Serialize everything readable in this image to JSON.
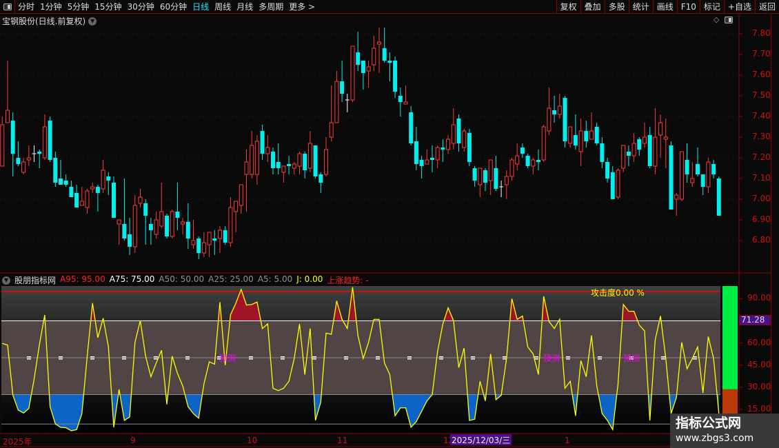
{
  "toolbar": {
    "periods": [
      "分时",
      "1分钟",
      "5分钟",
      "15分钟",
      "30分钟",
      "60分钟",
      "日线",
      "周线",
      "月线",
      "多周期",
      "更多 >"
    ],
    "active": "日线",
    "right_buttons": [
      "复权",
      "叠加",
      "多股",
      "统计",
      "画线",
      "F10",
      "标记",
      "+自选",
      "返回"
    ]
  },
  "chart": {
    "title": "宝钢股份(日线.前复权)",
    "price_labels": [
      "7.80",
      "7.70",
      "7.60",
      "7.50",
      "7.40",
      "7.30",
      "7.20",
      "7.10",
      "7.00",
      "6.90",
      "6.80"
    ],
    "colors": {
      "up": "#ff3b3b",
      "down": "#00f0f0",
      "doji": "#ffffff"
    },
    "candles": [
      [
        7.16,
        7.4,
        7.16,
        7.36
      ],
      [
        7.37,
        7.67,
        7.37,
        7.43
      ],
      [
        7.38,
        7.42,
        7.11,
        7.22
      ],
      [
        7.2,
        7.28,
        7.16,
        7.17
      ],
      [
        7.13,
        7.2,
        7.12,
        7.18
      ],
      [
        7.19,
        7.26,
        7.16,
        7.2
      ],
      [
        7.22,
        7.26,
        7.18,
        7.22
      ],
      [
        7.23,
        7.24,
        7.15,
        7.22
      ],
      [
        7.2,
        7.41,
        7.19,
        7.35
      ],
      [
        7.38,
        7.4,
        7.18,
        7.19
      ],
      [
        7.2,
        7.23,
        7.06,
        7.08
      ],
      [
        7.1,
        7.19,
        7.07,
        7.07
      ],
      [
        7.09,
        7.12,
        7.06,
        7.07
      ],
      [
        7.06,
        7.09,
        7.01,
        7.01
      ],
      [
        7.03,
        7.07,
        6.96,
        6.96
      ],
      [
        6.97,
        7.06,
        6.97,
        6.99
      ],
      [
        6.96,
        7.05,
        6.93,
        7.04
      ],
      [
        7.05,
        7.08,
        7.03,
        7.06
      ],
      [
        7.06,
        7.07,
        6.94,
        7.03
      ],
      [
        7.05,
        7.19,
        7.03,
        7.14
      ],
      [
        7.11,
        7.13,
        7.02,
        7.09
      ],
      [
        7.08,
        7.11,
        6.91,
        6.91
      ],
      [
        6.88,
        6.9,
        6.78,
        6.9
      ],
      [
        6.88,
        7.1,
        6.8,
        6.81
      ],
      [
        6.83,
        6.91,
        6.73,
        6.77
      ],
      [
        6.77,
        7.02,
        6.74,
        6.97
      ],
      [
        6.98,
        7.05,
        6.96,
        7.01
      ],
      [
        6.98,
        7.0,
        6.78,
        6.92
      ],
      [
        6.88,
        6.91,
        6.78,
        6.85
      ],
      [
        6.83,
        6.94,
        6.81,
        6.9
      ],
      [
        6.87,
        7.08,
        6.86,
        6.94
      ],
      [
        6.92,
        6.93,
        6.81,
        6.82
      ],
      [
        6.82,
        6.95,
        6.81,
        6.94
      ],
      [
        6.94,
        7.08,
        6.85,
        6.91
      ],
      [
        6.88,
        6.91,
        6.83,
        6.89
      ],
      [
        6.89,
        6.98,
        6.76,
        6.81
      ],
      [
        6.78,
        6.9,
        6.76,
        6.8
      ],
      [
        6.81,
        6.82,
        6.71,
        6.74
      ],
      [
        6.74,
        6.84,
        6.72,
        6.79
      ],
      [
        6.78,
        6.84,
        6.72,
        6.84
      ],
      [
        6.81,
        6.85,
        6.73,
        6.8
      ],
      [
        6.81,
        6.87,
        6.74,
        6.85
      ],
      [
        6.85,
        6.87,
        6.78,
        6.79
      ],
      [
        6.79,
        7.01,
        6.77,
        6.96
      ],
      [
        6.94,
        6.99,
        6.84,
        6.99
      ],
      [
        6.97,
        7.07,
        6.93,
        7.07
      ],
      [
        7.12,
        7.24,
        6.94,
        7.18
      ],
      [
        7.12,
        7.33,
        7.1,
        7.26
      ],
      [
        7.12,
        7.31,
        7.07,
        7.28
      ],
      [
        7.33,
        7.36,
        7.19,
        7.22
      ],
      [
        7.22,
        7.31,
        7.18,
        7.25
      ],
      [
        7.23,
        7.25,
        7.12,
        7.15
      ],
      [
        7.18,
        7.27,
        7.12,
        7.15
      ],
      [
        7.13,
        7.16,
        7.08,
        7.16
      ],
      [
        7.17,
        7.21,
        7.12,
        7.16
      ],
      [
        7.15,
        7.18,
        7.12,
        7.17
      ],
      [
        7.16,
        7.23,
        7.12,
        7.22
      ],
      [
        7.22,
        7.23,
        7.1,
        7.14
      ],
      [
        7.15,
        7.33,
        7.13,
        7.27
      ],
      [
        7.26,
        7.26,
        7.1,
        7.11
      ],
      [
        7.12,
        7.13,
        7.03,
        7.08
      ],
      [
        7.12,
        7.3,
        7.11,
        7.24
      ],
      [
        7.3,
        7.55,
        7.28,
        7.37
      ],
      [
        7.37,
        7.62,
        7.37,
        7.57
      ],
      [
        7.57,
        7.67,
        7.47,
        7.51
      ],
      [
        7.48,
        7.51,
        7.42,
        7.48
      ],
      [
        7.48,
        7.74,
        7.47,
        7.74
      ],
      [
        7.71,
        7.81,
        7.62,
        7.65
      ],
      [
        7.67,
        7.67,
        7.53,
        7.61
      ],
      [
        7.62,
        7.67,
        7.54,
        7.64
      ],
      [
        7.65,
        7.79,
        7.62,
        7.73
      ],
      [
        7.75,
        7.83,
        7.61,
        7.76
      ],
      [
        7.73,
        7.83,
        7.66,
        7.67
      ],
      [
        7.67,
        7.71,
        7.57,
        7.66
      ],
      [
        7.67,
        7.69,
        7.49,
        7.52
      ],
      [
        7.5,
        7.54,
        7.4,
        7.47
      ],
      [
        7.46,
        7.55,
        7.46,
        7.47
      ],
      [
        7.42,
        7.45,
        7.26,
        7.27
      ],
      [
        7.28,
        7.35,
        7.14,
        7.17
      ],
      [
        7.19,
        7.21,
        7.1,
        7.16
      ],
      [
        7.17,
        7.24,
        7.17,
        7.19
      ],
      [
        7.2,
        7.26,
        7.13,
        7.19
      ],
      [
        7.19,
        7.26,
        7.15,
        7.25
      ],
      [
        7.25,
        7.29,
        7.18,
        7.24
      ],
      [
        7.24,
        7.31,
        7.22,
        7.29
      ],
      [
        7.27,
        7.44,
        7.24,
        7.36
      ],
      [
        7.39,
        7.41,
        7.23,
        7.27
      ],
      [
        7.25,
        7.34,
        7.23,
        7.33
      ],
      [
        7.32,
        7.34,
        7.16,
        7.18
      ],
      [
        7.15,
        7.16,
        7.06,
        7.09
      ],
      [
        7.07,
        7.15,
        7.01,
        7.15
      ],
      [
        7.14,
        7.15,
        7.04,
        7.08
      ],
      [
        7.09,
        7.19,
        7.02,
        7.19
      ],
      [
        7.15,
        7.21,
        7.04,
        7.05
      ],
      [
        7.06,
        7.09,
        7.01,
        7.06
      ],
      [
        7.07,
        7.14,
        7.0,
        7.11
      ],
      [
        7.11,
        7.2,
        7.09,
        7.19
      ],
      [
        7.17,
        7.27,
        7.14,
        7.21
      ],
      [
        7.25,
        7.27,
        7.2,
        7.22
      ],
      [
        7.21,
        7.22,
        7.15,
        7.16
      ],
      [
        7.16,
        7.2,
        7.12,
        7.19
      ],
      [
        7.19,
        7.24,
        7.14,
        7.18
      ],
      [
        7.19,
        7.36,
        7.18,
        7.35
      ],
      [
        7.33,
        7.54,
        7.31,
        7.44
      ],
      [
        7.43,
        7.5,
        7.37,
        7.41
      ],
      [
        7.41,
        7.51,
        7.39,
        7.45
      ],
      [
        7.49,
        7.5,
        7.25,
        7.28
      ],
      [
        7.27,
        7.35,
        7.25,
        7.35
      ],
      [
        7.31,
        7.41,
        7.24,
        7.26
      ],
      [
        7.23,
        7.39,
        7.16,
        7.33
      ],
      [
        7.33,
        7.38,
        7.25,
        7.28
      ],
      [
        7.29,
        7.42,
        7.29,
        7.33
      ],
      [
        7.35,
        7.37,
        7.26,
        7.27
      ],
      [
        7.27,
        7.3,
        7.15,
        7.18
      ],
      [
        7.18,
        7.2,
        7.08,
        7.1
      ],
      [
        7.13,
        7.16,
        7.0,
        7.0
      ],
      [
        7.01,
        7.15,
        7.0,
        7.14
      ],
      [
        7.15,
        7.26,
        7.13,
        7.26
      ],
      [
        7.23,
        7.26,
        7.16,
        7.21
      ],
      [
        7.21,
        7.32,
        7.18,
        7.27
      ],
      [
        7.29,
        7.3,
        7.21,
        7.24
      ],
      [
        7.27,
        7.37,
        7.25,
        7.3
      ],
      [
        7.31,
        7.35,
        7.15,
        7.16
      ],
      [
        7.16,
        7.44,
        7.12,
        7.3
      ],
      [
        7.31,
        7.41,
        7.2,
        7.37
      ],
      [
        7.29,
        7.39,
        7.15,
        7.3
      ],
      [
        7.26,
        7.28,
        6.95,
        6.95
      ],
      [
        7.0,
        7.03,
        6.92,
        7.02
      ],
      [
        7.0,
        7.23,
        6.99,
        7.23
      ],
      [
        7.19,
        7.27,
        7.08,
        7.12
      ],
      [
        7.08,
        7.18,
        7.06,
        7.1
      ],
      [
        7.17,
        7.25,
        7.11,
        7.12
      ],
      [
        7.12,
        7.12,
        7.02,
        7.06
      ],
      [
        7.06,
        7.2,
        7.03,
        7.18
      ],
      [
        7.17,
        7.19,
        7.1,
        7.12
      ],
      [
        7.1,
        7.11,
        6.92,
        6.92
      ]
    ]
  },
  "indicator": {
    "name": "股朋指标网",
    "params": [
      {
        "label": "A95: 95.00",
        "color": "#ff2020"
      },
      {
        "label": "A75: 75.00",
        "color": "#ffffff"
      },
      {
        "label": "A50: 50.00",
        "color": "#909090"
      },
      {
        "label": "A25: 25.00",
        "color": "#909090"
      },
      {
        "label": "A5: 5.00",
        "color": "#909090"
      },
      {
        "label": "J: 0.00",
        "color": "#ffff00"
      },
      {
        "label": "上涨趋势: -",
        "color": "#ff2020"
      }
    ],
    "axis_labels": [
      "90.00",
      "60.00",
      "45.00",
      "30.00",
      "15.00"
    ],
    "current_value": "71.28",
    "attack_label": "攻击度0.00 %",
    "forecast_label": "预测",
    "levels": [
      95,
      75,
      50,
      25,
      5
    ],
    "gauge_fill": 0.81,
    "j": [
      59.7,
      58.6,
      24.6,
      14.5,
      12.5,
      15.6,
      35.5,
      58.9,
      79,
      16.8,
      5.1,
      2.8,
      2.5,
      0.5,
      1.2,
      12.1,
      51,
      87,
      63.6,
      76.8,
      57.3,
      2.8,
      28.5,
      7.5,
      9.8,
      60.4,
      75.2,
      51.1,
      37.1,
      46.4,
      55,
      18.4,
      51.1,
      39.4,
      30.8,
      16.8,
      12.1,
      9,
      32.4,
      47.2,
      45.6,
      87.7,
      44.9,
      79.1,
      86.9,
      96.3,
      85.7,
      86.1,
      87.7,
      69.8,
      72.9,
      29.3,
      27.7,
      29.3,
      34,
      49.5,
      72.9,
      38.6,
      69.8,
      7.5,
      19.9,
      66.7,
      65.9,
      88.5,
      76,
      69.8,
      97.8,
      65.1,
      49.5,
      60.4,
      76,
      76,
      46.4,
      38.6,
      10.6,
      16,
      16,
      2.8,
      6.7,
      13.7,
      20.7,
      25,
      54.2,
      72.9,
      83.8,
      75.2,
      43.3,
      56.5,
      7.5,
      8.3,
      34,
      20.7,
      52.6,
      21.5,
      24.6,
      49.5,
      90,
      76,
      78.3,
      57.3,
      52.6,
      38.6,
      91.6,
      74.5,
      69.8,
      76,
      29.3,
      34,
      10.6,
      48,
      37.1,
      65.1,
      30.8,
      12.1,
      7.5,
      1.2,
      32.4,
      86.1,
      81.5,
      81.5,
      72.1,
      68.2,
      7.5,
      62,
      78.3,
      49.5,
      12.1,
      23,
      60.4,
      42.5,
      49.5,
      57.3,
      26.2,
      64.3,
      49.5,
      12.1
    ]
  },
  "date_axis": {
    "year": "2025年",
    "months": [
      "9",
      "10",
      "11",
      "12",
      "1"
    ],
    "cursor_date": "2025/12/03/三"
  },
  "watermark": {
    "line1": "指标公式网",
    "line2": "www.zbgs3.com"
  }
}
